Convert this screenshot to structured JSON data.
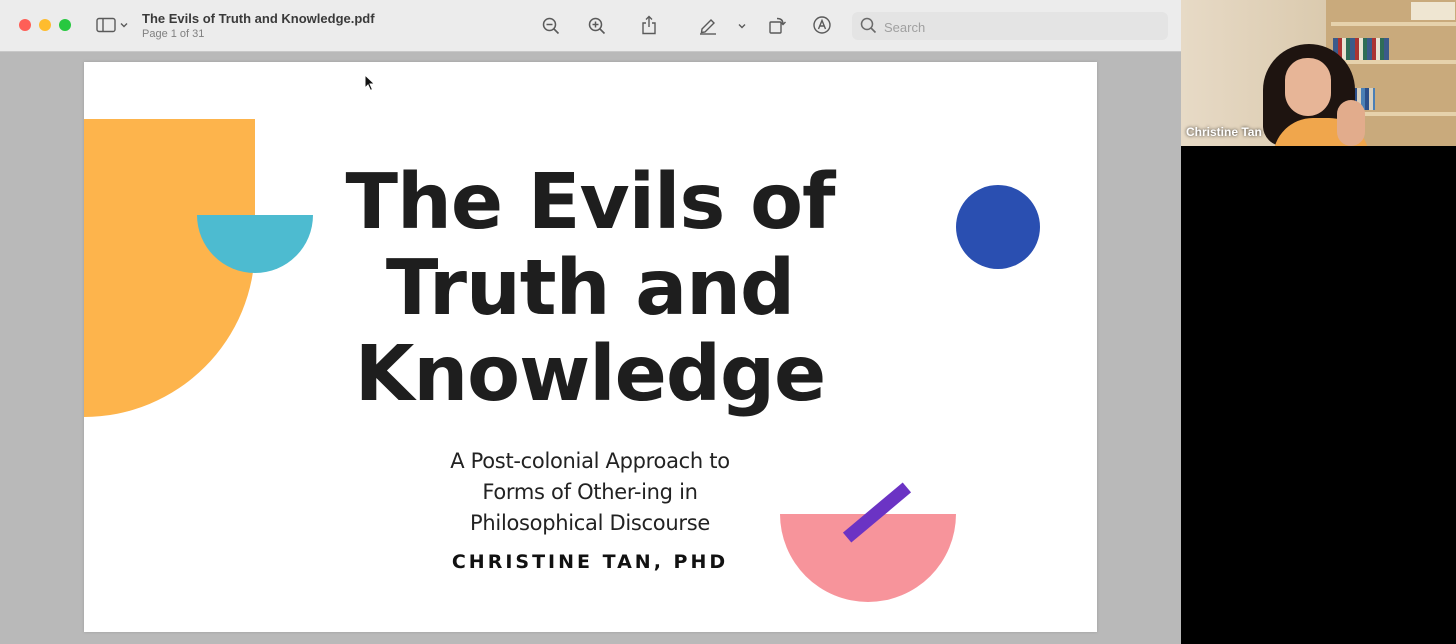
{
  "viewer": {
    "title": "The Evils of Truth and Knowledge.pdf",
    "page_info": "Page 1 of 31",
    "search_placeholder": "Search",
    "toolbar_icons": [
      "sidebar-icon",
      "chevron-down-icon",
      "zoom-out-icon",
      "zoom-in-icon",
      "share-icon",
      "highlighter-icon",
      "chevron-down-icon",
      "rotate-icon",
      "markup-icon",
      "search-icon"
    ]
  },
  "slide": {
    "title_lines": [
      "The Evils of",
      "Truth and",
      "Knowledge"
    ],
    "subtitle_lines": [
      "A Post-colonial Approach to",
      "Forms of Other-ing in",
      "Philosophical Discourse"
    ],
    "author": "CHRISTINE TAN, PHD",
    "colors": {
      "orange": "#fdb44c",
      "cyan": "#4dbbd0",
      "blue": "#2a4fb1",
      "pink": "#f7949b",
      "purple": "#6b33c4"
    }
  },
  "video": {
    "participant_name": "Christine Tan"
  }
}
